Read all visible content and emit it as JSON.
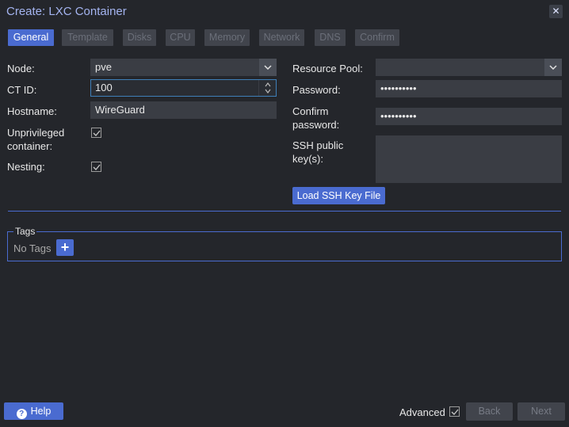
{
  "window": {
    "title": "Create: LXC Container"
  },
  "tabs": [
    {
      "label": "General"
    },
    {
      "label": "Template"
    },
    {
      "label": "Disks"
    },
    {
      "label": "CPU"
    },
    {
      "label": "Memory"
    },
    {
      "label": "Network"
    },
    {
      "label": "DNS"
    },
    {
      "label": "Confirm"
    }
  ],
  "form": {
    "node": {
      "label": "Node:",
      "value": "pve"
    },
    "ctid": {
      "label": "CT ID:",
      "value": "100"
    },
    "hostname": {
      "label": "Hostname:",
      "value": "WireGuard"
    },
    "unprivileged": {
      "label_line1": "Unprivileged",
      "label_line2": "container:",
      "checked": true
    },
    "nesting": {
      "label": "Nesting:",
      "checked": true
    },
    "resource_pool": {
      "label": "Resource Pool:",
      "value": ""
    },
    "password": {
      "label": "Password:",
      "value": "••••••••••"
    },
    "confirm_password": {
      "label_line1": "Confirm",
      "label_line2": "password:",
      "value": "••••••••••"
    },
    "ssh_keys": {
      "label_line1": "SSH public",
      "label_line2": "key(s):",
      "value": ""
    },
    "load_ssh_label": "Load SSH Key File"
  },
  "tags": {
    "legend": "Tags",
    "empty_text": "No Tags",
    "add_label": "+"
  },
  "footer": {
    "help_label": "Help",
    "advanced_label": "Advanced",
    "advanced_checked": true,
    "back_label": "Back",
    "next_label": "Next"
  },
  "colors": {
    "accent": "#4a6bd0",
    "title": "#a4b4f0",
    "background": "#24262b",
    "field": "#3a3d44"
  }
}
